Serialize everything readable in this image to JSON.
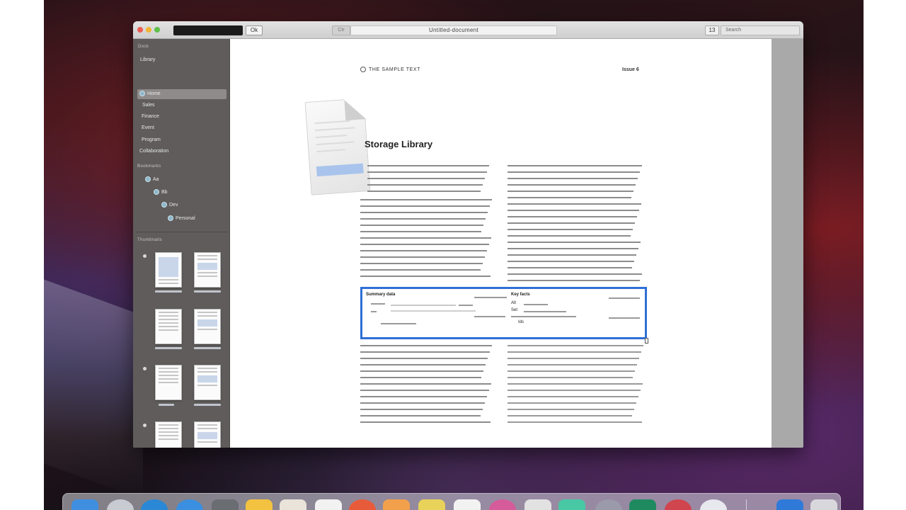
{
  "window": {
    "title": "Untitled-document",
    "toolbar_button": "Ok",
    "back_button": "Ctr",
    "page_number": "13",
    "search_placeholder": "Search"
  },
  "sidebar": {
    "header": "Dock",
    "items": [
      {
        "label": "Library"
      },
      {
        "label": "Home"
      },
      {
        "label": "Sales"
      },
      {
        "label": "Finance"
      },
      {
        "label": "Event"
      },
      {
        "label": "Program"
      },
      {
        "label": "Collaboration"
      }
    ],
    "section2_header": "Bookmarks",
    "tree": [
      {
        "label": "Aa"
      },
      {
        "label": "Bb"
      },
      {
        "label": "Dev"
      },
      {
        "label": "Personal"
      }
    ],
    "thumbnails_header": "Thumbnails"
  },
  "document": {
    "header_left": "THE SAMPLE TEXT",
    "header_right": "Issue 6",
    "heading": "Storage Library",
    "callout_left_title": "Summary data",
    "callout_right_title": "Key facts",
    "callout_right_items": [
      "Alt",
      "Set",
      "Ids"
    ]
  },
  "colors": {
    "accent": "#2f6fd6",
    "sidebar_bg": "#5f5c5b",
    "page_bg": "#ffffff"
  },
  "dock": {
    "icons": [
      "finder-icon",
      "safari-icon",
      "mail-icon",
      "app-store-icon",
      "calendar-icon",
      "notes-icon",
      "reminders-icon",
      "photos-icon",
      "stickies-icon",
      "maps-icon",
      "preview-icon",
      "pages-icon",
      "numbers-icon",
      "keynote-icon",
      "music-icon",
      "podcasts-icon",
      "tv-icon",
      "news-icon",
      "system-preferences-icon",
      "downloads-icon",
      "trash-icon"
    ]
  }
}
